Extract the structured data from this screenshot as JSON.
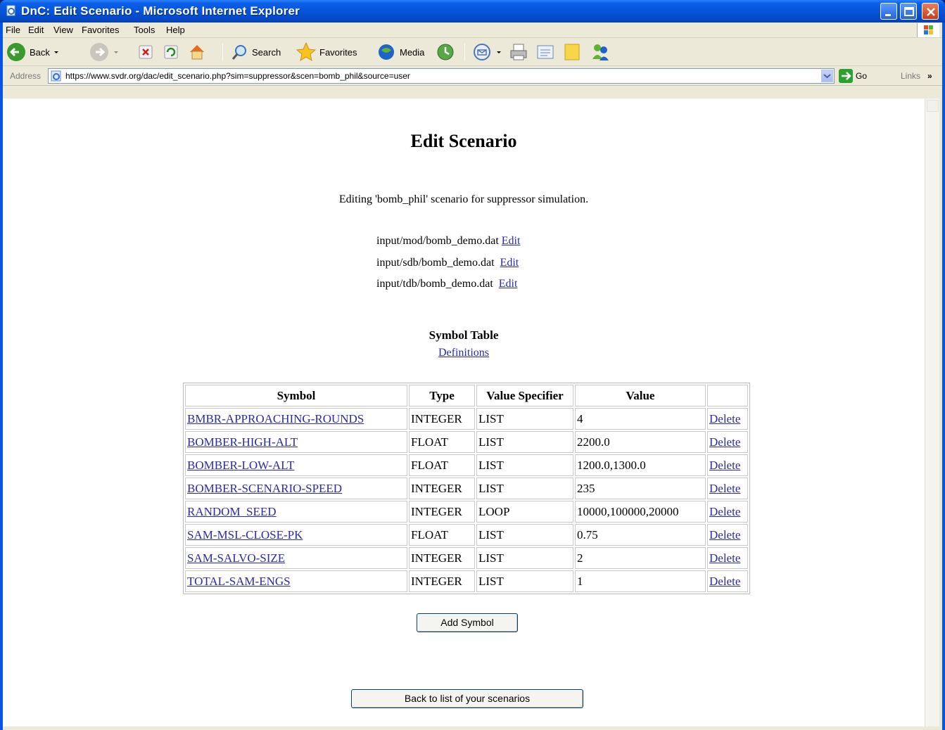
{
  "window": {
    "title": "DnC: Edit Scenario - Microsoft Internet Explorer",
    "icons": [
      "ie-page-icon",
      "minimize-icon",
      "maximize-icon",
      "close-icon"
    ]
  },
  "menu": {
    "items": [
      {
        "label": "File"
      },
      {
        "label": "Edit"
      },
      {
        "label": "View"
      },
      {
        "label": "Favorites"
      },
      {
        "label": "Tools"
      },
      {
        "label": "Help"
      }
    ]
  },
  "toolbar": {
    "back": "Back",
    "search": "Search",
    "favorites": "Favorites",
    "media": "Media"
  },
  "address": {
    "label": "Address",
    "url": "https://www.svdr.org/dac/edit_scenario.php?sim=suppressor&scen=bomb_phil&source=user",
    "go": "Go",
    "links": "Links",
    "links_chevron": "»"
  },
  "page": {
    "heading": "Edit Scenario",
    "intro": "Editing 'bomb_phil' scenario for suppressor simulation.",
    "files": [
      {
        "path": "input/mod/bomb_demo.dat",
        "action": "Edit"
      },
      {
        "path": "input/sdb/bomb_demo.dat",
        "action": "Edit"
      },
      {
        "path": "input/tdb/bomb_demo.dat",
        "action": "Edit"
      }
    ],
    "symbol_table_title": "Symbol Table",
    "definitions_link": "Definitions",
    "table": {
      "headers": [
        "Symbol",
        "Type",
        "Value Specifier",
        "Value",
        ""
      ],
      "rows": [
        {
          "symbol": "BMBR-APPROACHING-ROUNDS",
          "type": "INTEGER",
          "spec": "LIST",
          "value": "4",
          "action": "Delete"
        },
        {
          "symbol": "BOMBER-HIGH-ALT",
          "type": "FLOAT",
          "spec": "LIST",
          "value": "2200.0",
          "action": "Delete"
        },
        {
          "symbol": "BOMBER-LOW-ALT",
          "type": "FLOAT",
          "spec": "LIST",
          "value": "1200.0,1300.0",
          "action": "Delete"
        },
        {
          "symbol": "BOMBER-SCENARIO-SPEED",
          "type": "INTEGER",
          "spec": "LIST",
          "value": "235",
          "action": "Delete"
        },
        {
          "symbol": "RANDOM_SEED",
          "type": "INTEGER",
          "spec": "LOOP",
          "value": "10000,100000,20000",
          "action": "Delete"
        },
        {
          "symbol": "SAM-MSL-CLOSE-PK",
          "type": "FLOAT",
          "spec": "LIST",
          "value": "0.75",
          "action": "Delete"
        },
        {
          "symbol": "SAM-SALVO-SIZE",
          "type": "INTEGER",
          "spec": "LIST",
          "value": "2",
          "action": "Delete"
        },
        {
          "symbol": "TOTAL-SAM-ENGS",
          "type": "INTEGER",
          "spec": "LIST",
          "value": "1",
          "action": "Delete"
        }
      ]
    },
    "add_symbol_button": "Add Symbol",
    "back_button": "Back to list of your scenarios"
  },
  "colors": {
    "titlebar": "#0553d8",
    "chrome": "#ece9d8",
    "link": "#2a2aa6"
  }
}
